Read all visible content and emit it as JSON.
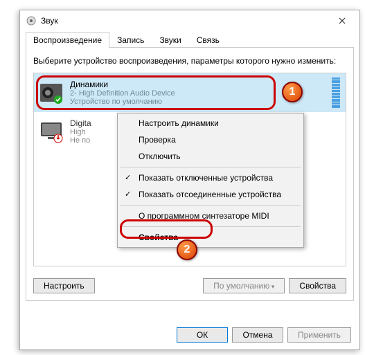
{
  "window": {
    "title": "Звук"
  },
  "tabs": [
    "Воспроизведение",
    "Запись",
    "Звуки",
    "Связь"
  ],
  "instruction": "Выберите устройство воспроизведения, параметры которого нужно изменить:",
  "devices": [
    {
      "name": "Динамики",
      "sub1": "2- High Definition Audio Device",
      "sub2": "Устройство по умолчанию"
    },
    {
      "name": "Digita",
      "sub1": "High",
      "sub2": "Не по"
    }
  ],
  "context_menu": {
    "configure": "Настроить динамики",
    "test": "Проверка",
    "disable": "Отключить",
    "show_disabled": "Показать отключенные устройства",
    "show_disconnected": "Показать отсоединенные устройства",
    "midi": "О программном синтезаторе MIDI",
    "properties": "Свойства"
  },
  "buttons": {
    "configure": "Настроить",
    "default": "По умолчанию",
    "properties": "Свойства",
    "ok": "ОК",
    "cancel": "Отмена",
    "apply": "Применить"
  },
  "badges": {
    "one": "1",
    "two": "2"
  }
}
